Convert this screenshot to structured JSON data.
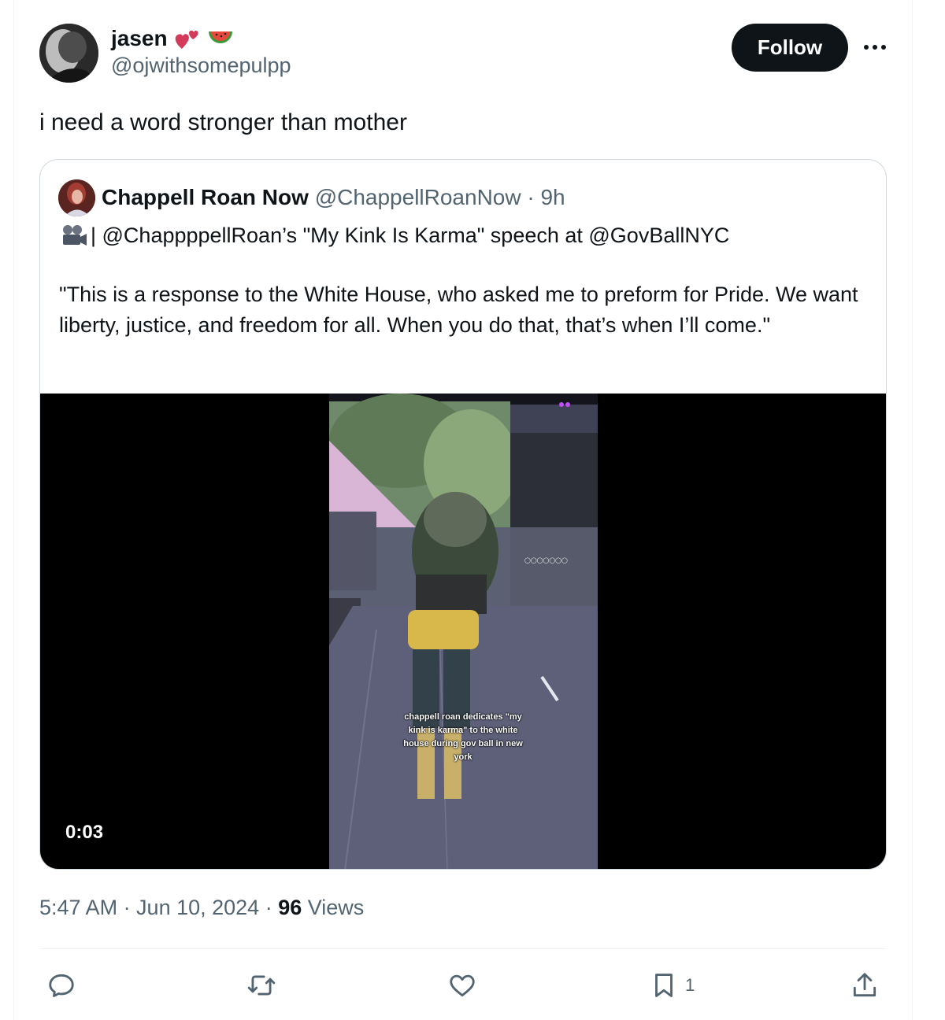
{
  "tweet": {
    "author": {
      "name": "jasen",
      "handle": "@ojwithsomepulpp",
      "emoji_icons": [
        "two-hearts-icon",
        "watermelon-icon"
      ]
    },
    "follow_label": "Follow",
    "text": "i need a word stronger than mother",
    "timestamp": "5:47 AM · Jun 10, 2024 · ",
    "views_count": "96",
    "views_label": " Views"
  },
  "quoted": {
    "name": "Chappell Roan Now",
    "handle": "@ChappellRoanNow",
    "sep": " · ",
    "time": "9h",
    "line1": "| @ChappppellRoan’s \"My Kink Is Karma\" speech at @GovBallNYC",
    "quote": " \"This is a response to the White House, who asked me to preform for Pride. We want liberty, justice, and freedom for all. When you do that, that’s when I’ll come.\"",
    "video": {
      "caption": "chappell roan dedicates \"my kink is karma\" to the white house during gov ball in new york",
      "duration": "0:03"
    }
  },
  "actions": {
    "reply_icon": "reply-icon",
    "retweet_icon": "retweet-icon",
    "like_icon": "heart-icon",
    "bookmark_count": "1",
    "share_icon": "share-icon"
  },
  "colors": {
    "text": "#0f1419",
    "secondary": "#536471",
    "border": "#cfd9de",
    "follow_bg": "#0f1419"
  }
}
